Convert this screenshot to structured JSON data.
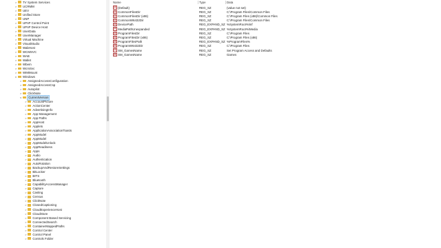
{
  "tree": {
    "items": [
      {
        "label": "TV System Services",
        "depth": 0,
        "expander": ">"
      },
      {
        "label": "UCRMM",
        "depth": 0,
        "expander": ">"
      },
      {
        "label": "UEV",
        "depth": 0,
        "expander": ">"
      },
      {
        "label": "Unified Store",
        "depth": 0,
        "expander": ">"
      },
      {
        "label": "UNP",
        "depth": 0,
        "expander": ">"
      },
      {
        "label": "UPnP Control Point",
        "depth": 0,
        "expander": ">"
      },
      {
        "label": "UPnP Device Host",
        "depth": 0,
        "expander": ">"
      },
      {
        "label": "UserData",
        "depth": 0,
        "expander": ">"
      },
      {
        "label": "UserManager",
        "depth": 0,
        "expander": ">"
      },
      {
        "label": "Virtual Machine",
        "depth": 0,
        "expander": ">"
      },
      {
        "label": "VisualStudio",
        "depth": 0,
        "expander": ">"
      },
      {
        "label": "WabHost",
        "depth": 0,
        "expander": ">"
      },
      {
        "label": "WCMSVC",
        "depth": 0,
        "expander": ">"
      },
      {
        "label": "WAB",
        "depth": 0,
        "expander": ">"
      },
      {
        "label": "Wallet",
        "depth": 0,
        "expander": ">"
      },
      {
        "label": "Wbem",
        "depth": 0,
        "expander": ">"
      },
      {
        "label": "WcmSvc",
        "depth": 0,
        "expander": ">"
      },
      {
        "label": "WIMMount",
        "depth": 0,
        "expander": ">"
      },
      {
        "label": "Windows",
        "depth": 0,
        "expander": "v"
      },
      {
        "label": "AssignedAccessConfiguration",
        "depth": 1,
        "expander": ">"
      },
      {
        "label": "AssignedAccessCsp",
        "depth": 1,
        "expander": ">"
      },
      {
        "label": "Autopilot",
        "depth": 1,
        "expander": ">"
      },
      {
        "label": "ClickNote",
        "depth": 1,
        "expander": ">"
      },
      {
        "label": "CurrentVersion",
        "depth": 1,
        "expander": "v",
        "selected": true
      },
      {
        "label": "AccountPicture",
        "depth": 2,
        "expander": ">"
      },
      {
        "label": "ActionCenter",
        "depth": 2,
        "expander": ">"
      },
      {
        "label": "AdvertisingInfo",
        "depth": 2,
        "expander": ">"
      },
      {
        "label": "App Management",
        "depth": 2,
        "expander": ">"
      },
      {
        "label": "App Paths",
        "depth": 2,
        "expander": ">"
      },
      {
        "label": "AppHost",
        "depth": 2,
        "expander": ">"
      },
      {
        "label": "Applets",
        "depth": 2,
        "expander": ">"
      },
      {
        "label": "ApplicationAssociationToasts",
        "depth": 2,
        "expander": ">"
      },
      {
        "label": "AppModel",
        "depth": 2,
        "expander": ">"
      },
      {
        "label": "AppModel",
        "depth": 2,
        "expander": ">"
      },
      {
        "label": "AppModelUnlock",
        "depth": 2,
        "expander": ">"
      },
      {
        "label": "AppReadiness",
        "depth": 2,
        "expander": ">"
      },
      {
        "label": "Apps",
        "depth": 2,
        "expander": ">"
      },
      {
        "label": "Audio",
        "depth": 2,
        "expander": ">"
      },
      {
        "label": "Authentication",
        "depth": 2,
        "expander": ">"
      },
      {
        "label": "AutoRotation",
        "depth": 2,
        "expander": ">"
      },
      {
        "label": "BackupAndRestoreSettings",
        "depth": 2,
        "expander": ">"
      },
      {
        "label": "BitLocker",
        "depth": 2,
        "expander": ">"
      },
      {
        "label": "BITS",
        "depth": 2,
        "expander": ">"
      },
      {
        "label": "Bluetooth",
        "depth": 2,
        "expander": ">"
      },
      {
        "label": "CapabilityAccessManager",
        "depth": 2,
        "expander": ">"
      },
      {
        "label": "Capture",
        "depth": 2,
        "expander": ">"
      },
      {
        "label": "Casting",
        "depth": 2,
        "expander": ">"
      },
      {
        "label": "Census",
        "depth": 2,
        "expander": ">"
      },
      {
        "label": "ClickNote",
        "depth": 2,
        "expander": ">"
      },
      {
        "label": "ClosedCaptioning",
        "depth": 2,
        "expander": ">"
      },
      {
        "label": "CloudExperienceHost",
        "depth": 2,
        "expander": ">"
      },
      {
        "label": "CloudStore",
        "depth": 2,
        "expander": ">"
      },
      {
        "label": "Component Based Servicing",
        "depth": 2,
        "expander": ">"
      },
      {
        "label": "ConnectedSearch",
        "depth": 2,
        "expander": ">"
      },
      {
        "label": "ContainerMappedPaths",
        "depth": 2,
        "expander": ">"
      },
      {
        "label": "Control Center",
        "depth": 2,
        "expander": ">"
      },
      {
        "label": "Control Panel",
        "depth": 2,
        "expander": ">"
      },
      {
        "label": "Controls Folder",
        "depth": 2,
        "expander": ">"
      }
    ]
  },
  "list": {
    "columns": {
      "name": "Name",
      "type": "Type",
      "data": "Data"
    },
    "rows": [
      {
        "name": "(Default)",
        "type": "REG_SZ",
        "data": "(value not set)",
        "icon": "ab"
      },
      {
        "name": "CommonFilesDir",
        "type": "REG_SZ",
        "data": "C:\\Program Files\\Common Files",
        "icon": "ab"
      },
      {
        "name": "CommonFilesDir (x86)",
        "type": "REG_SZ",
        "data": "C:\\Program Files (x86)\\Common Files",
        "icon": "ab"
      },
      {
        "name": "CommonW6432Dir",
        "type": "REG_SZ",
        "data": "C:\\Program Files\\Common Files",
        "icon": "ab"
      },
      {
        "name": "DevicePath",
        "type": "REG_EXPAND_SZ",
        "data": "%SystemRoot%\\inf",
        "icon": "ab"
      },
      {
        "name": "MediaPathUnexpanded",
        "type": "REG_EXPAND_SZ",
        "data": "%SystemRoot%\\Media",
        "icon": "ab"
      },
      {
        "name": "ProgramFilesDir",
        "type": "REG_SZ",
        "data": "C:\\Program Files",
        "icon": "ab"
      },
      {
        "name": "ProgramFilesDir (x86)",
        "type": "REG_SZ",
        "data": "C:\\Program Files (x86)",
        "icon": "ab"
      },
      {
        "name": "ProgramFilesPath",
        "type": "REG_EXPAND_SZ",
        "data": "%ProgramFiles%",
        "icon": "ab"
      },
      {
        "name": "ProgramW6432Dir",
        "type": "REG_SZ",
        "data": "C:\\Program Files",
        "icon": "ab"
      },
      {
        "name": "SM_GamesName",
        "type": "REG_SZ",
        "data": "Set Program Access and Defaults",
        "icon": "ab"
      },
      {
        "name": "SM_GamesName",
        "type": "REG_SZ",
        "data": "Games",
        "icon": "ab"
      }
    ]
  },
  "colors": {
    "folder": "#e8b93a",
    "selection": "#cce4f7"
  }
}
